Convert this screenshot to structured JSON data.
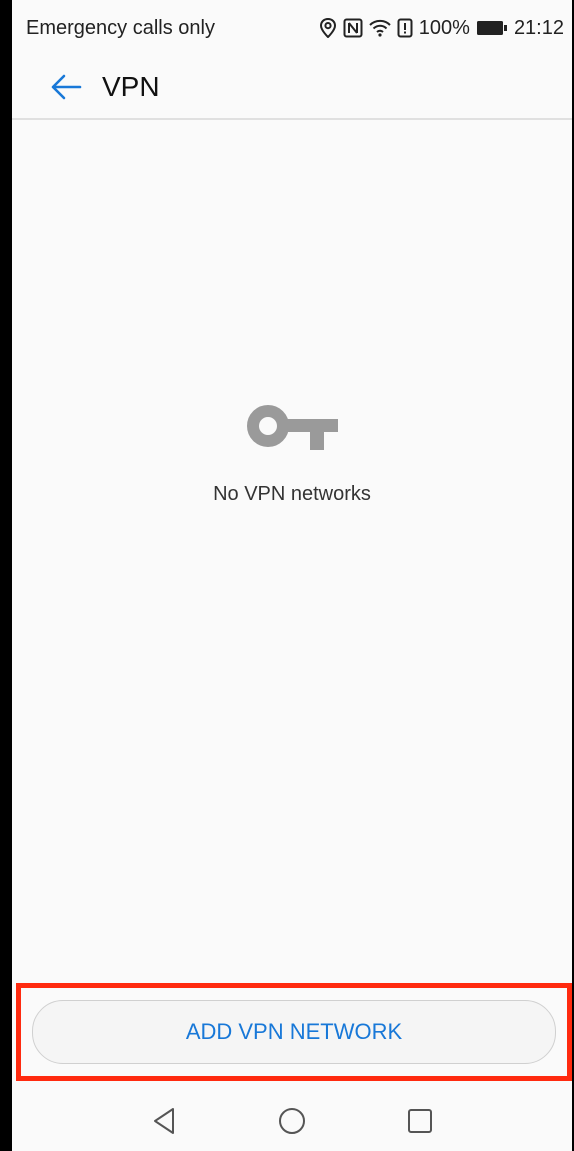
{
  "status_bar": {
    "carrier": "Emergency calls only",
    "battery": "100%",
    "time": "21:12",
    "icons": [
      "location-icon",
      "nfc-icon",
      "wifi-icon",
      "alert-icon",
      "battery-icon"
    ]
  },
  "header": {
    "title": "VPN",
    "back_icon": "back-arrow-icon"
  },
  "empty_state": {
    "icon": "key-icon",
    "message": "No VPN networks"
  },
  "actions": {
    "add_label": "ADD VPN NETWORK"
  },
  "navigation": {
    "buttons": [
      "back-triangle-icon",
      "home-circle-icon",
      "recents-square-icon"
    ]
  },
  "colors": {
    "accent": "#1878d8",
    "highlight": "#ff2a0f",
    "background": "#fafafa"
  }
}
